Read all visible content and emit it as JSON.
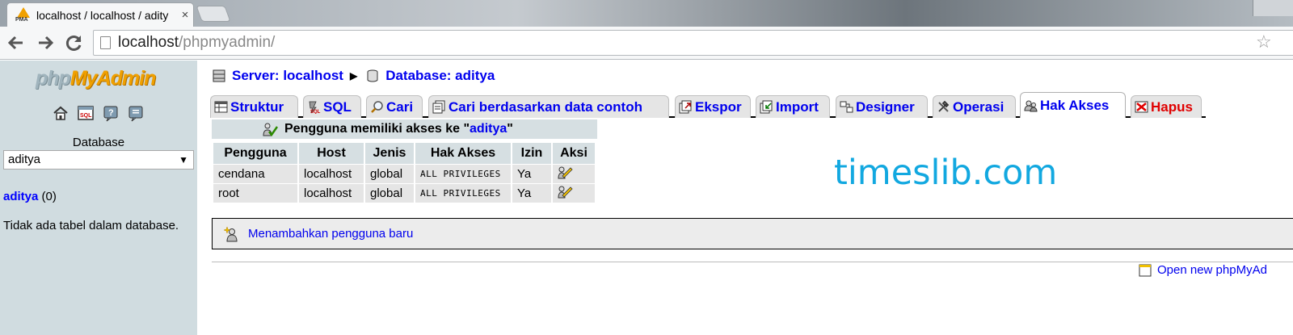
{
  "browser": {
    "tab_title": "localhost / localhost / adity",
    "tab_favicon_text": "PMA",
    "close_glyph": "×",
    "url_host": "localhost",
    "url_path": "/phpmyadmin/"
  },
  "left": {
    "logo_php": "php",
    "logo_my": "MyAdmin",
    "icons": [
      "home-icon",
      "sql-query-icon",
      "help-icon",
      "docs-icon"
    ],
    "database_label": "Database",
    "database_selected": "aditya",
    "db_name": "aditya",
    "db_count": "(0)",
    "no_tables": "Tidak ada tabel dalam database."
  },
  "breadcrumb": {
    "server": "Server: localhost",
    "database": "Database: aditya"
  },
  "tabs": [
    {
      "label": "Struktur",
      "icon": "structure-icon"
    },
    {
      "label": "SQL",
      "icon": "sql-icon"
    },
    {
      "label": "Cari",
      "icon": "search-icon"
    },
    {
      "label": "Cari berdasarkan data contoh",
      "icon": "query-icon"
    },
    {
      "label": "Ekspor",
      "icon": "export-icon"
    },
    {
      "label": "Import",
      "icon": "import-icon"
    },
    {
      "label": "Designer",
      "icon": "designer-icon"
    },
    {
      "label": "Operasi",
      "icon": "operations-icon"
    },
    {
      "label": "Hak Akses",
      "icon": "privileges-icon"
    },
    {
      "label": "Hapus",
      "icon": "drop-icon"
    }
  ],
  "caption": {
    "prefix": "Pengguna memiliki akses ke \"",
    "db": "aditya",
    "suffix": "\""
  },
  "table": {
    "headers": [
      "Pengguna",
      "Host",
      "Jenis",
      "Hak Akses",
      "Izin",
      "Aksi"
    ],
    "rows": [
      [
        "cendana",
        "localhost",
        "global",
        "ALL PRIVILEGES",
        "Ya"
      ],
      [
        "root",
        "localhost",
        "global",
        "ALL PRIVILEGES",
        "Ya"
      ]
    ]
  },
  "add_user": "Menambahkan pengguna baru",
  "open_new": "Open new phpMyAd",
  "watermark": "timeslib.com",
  "colors": {
    "link": "#0000ee",
    "danger": "#e00000",
    "watermark": "#12a8e0",
    "leftframe": "#d0dce0"
  }
}
